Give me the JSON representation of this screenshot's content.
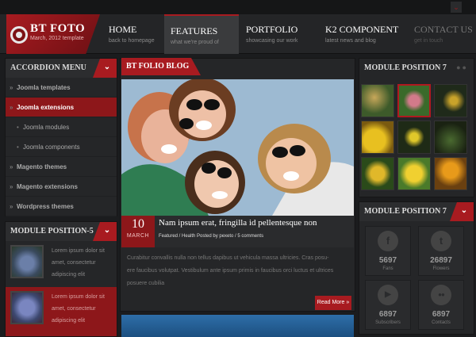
{
  "topbar": {
    "toggle_icon": "chevron-down-icon",
    "toggle_glyph": "⌄"
  },
  "logo": {
    "title": "BT FOTO",
    "subtitle": "March, 2012 template",
    "icon": "camera-lens-icon"
  },
  "nav": [
    {
      "title": "HOME",
      "subtitle": "back to homepage"
    },
    {
      "title": "FEATURES",
      "subtitle": "what we're proud of"
    },
    {
      "title": "PORTFOLIO",
      "subtitle": "showcasing our work"
    },
    {
      "title": "K2 COMPONENT",
      "subtitle": "latest news and blog"
    },
    {
      "title": "CONTACT US",
      "subtitle": "get in touch"
    }
  ],
  "accordion": {
    "title": "ACCORDION MENU",
    "items": [
      "Joomla templates",
      "Joomla extensions",
      "Joomla modules",
      "Joomla components",
      "Magento themes",
      "Magento extensions",
      "Wordpress themes"
    ]
  },
  "module5": {
    "title": "MODULE POSITION-5",
    "items": [
      {
        "l1": "Lorem ipsum dolor sit",
        "l2": "amet, consectetur",
        "l3": "adipiscing elit"
      },
      {
        "l1": "Lorem ipsum dolor sit",
        "l2": "amet, consectetur",
        "l3": "adipiscing elit"
      }
    ]
  },
  "blog": {
    "section_title": "BT FOLIO BLOG",
    "day": "10",
    "month": "MARCH",
    "post_title": "Nam ipsum erat, fringilla id pellentesque non",
    "meta": "Featured / Health  Posted by pexeto / 5 comments",
    "body_l1": "Curabitur convallis nulla non tellus dapibus ut vehicula massa ultricies. Cras posu-",
    "body_l2": "ere faucibus volutpat. Vestibulum ante ipsum primis in faucibus orci luctus et ultrices",
    "body_l3": "posuere cubilia",
    "read_more": "Read More »"
  },
  "module7a": {
    "title": "MODULE POSITION 7",
    "dots": "●●"
  },
  "module7b": {
    "title": "MODULE POSITION 7",
    "social": [
      {
        "count": "5697",
        "label": "Fans",
        "icon": "facebook-icon",
        "glyph": "f"
      },
      {
        "count": "26897",
        "label": "Flowers",
        "icon": "twitter-icon",
        "glyph": "t"
      },
      {
        "count": "6897",
        "label": "Subscribers",
        "icon": "youtube-icon",
        "glyph": "▶"
      },
      {
        "count": "6897",
        "label": "Contacts",
        "icon": "flickr-icon",
        "glyph": "●●"
      }
    ]
  },
  "colors": {
    "accent": "#a81b20",
    "background": "#1b1c1e"
  }
}
